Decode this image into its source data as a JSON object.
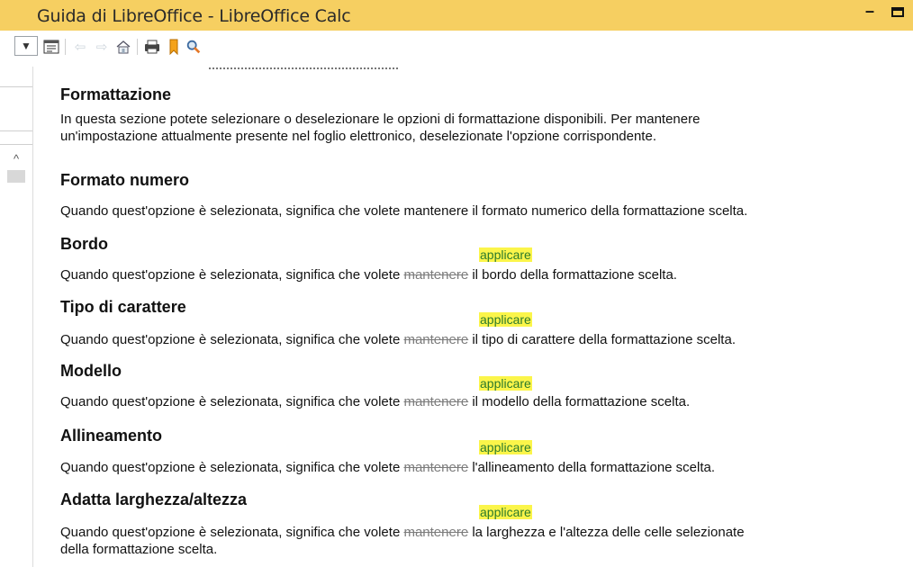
{
  "window": {
    "title": "Guida di LibreOffice - LibreOffice Calc"
  },
  "toolbar": {
    "icons": [
      "index-toggle-icon",
      "back-icon",
      "forward-icon",
      "home-icon",
      "print-icon",
      "bookmark-icon",
      "find-icon"
    ]
  },
  "sections": [
    {
      "heading": "Formattazione",
      "text1": "In questa sezione potete selezionare o deselezionare le opzioni di formattazione disponibili. Per mantenere",
      "text2": "un'impostazione attualmente presente nel foglio elettronico, deselezionate l'opzione corrispondente."
    },
    {
      "heading": "Formato numero",
      "text": "Quando quest'opzione è selezionata, significa che volete mantenere il formato numerico della formattazione scelta."
    },
    {
      "heading": "Bordo",
      "before": "Quando quest'opzione è selezionata, significa che volete ",
      "deleted": "mantenere",
      "inserted": "applicare",
      "after": " il bordo della formattazione scelta."
    },
    {
      "heading": "Tipo di carattere",
      "before": "Quando quest'opzione è selezionata, significa che volete ",
      "deleted": "mantenere",
      "inserted": "applicare",
      "after": " il tipo di carattere della formattazione scelta."
    },
    {
      "heading": "Modello",
      "before": "Quando quest'opzione è selezionata, significa che volete ",
      "deleted": "mantenere",
      "inserted": "applicare",
      "after": " il modello della formattazione scelta."
    },
    {
      "heading": "Allineamento",
      "before": "Quando quest'opzione è selezionata, significa che volete ",
      "deleted": "mantenere",
      "inserted": "applicare",
      "after": " l'allineamento della formattazione scelta."
    },
    {
      "heading": "Adatta larghezza/altezza",
      "before": "Quando quest'opzione è selezionata, significa che volete ",
      "deleted": "mantenere",
      "inserted": "applicare",
      "after": " la larghezza e l'altezza delle celle selezionate",
      "line2": "della formattazione scelta."
    }
  ],
  "colors": {
    "titlebar": "#f6cf61",
    "highlight": "#fbf54a",
    "inserted_text": "#2c7a2c",
    "deleted_text": "#7c7c7c"
  }
}
